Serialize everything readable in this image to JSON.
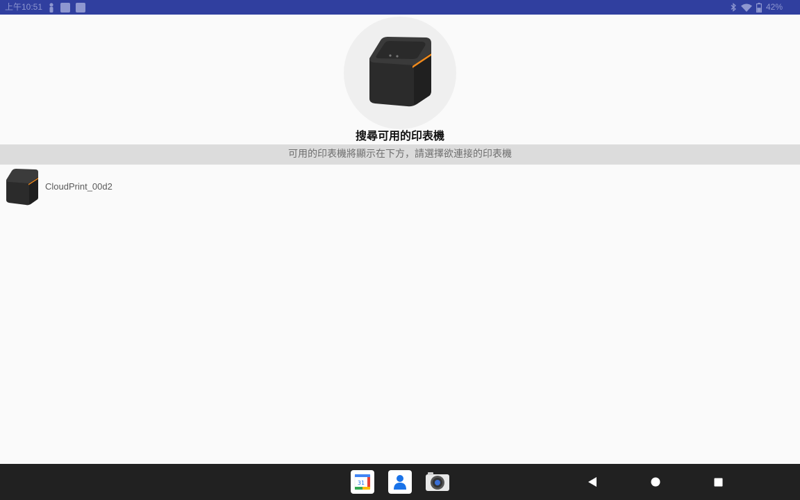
{
  "status_bar": {
    "time": "上午10:51",
    "battery": "42%",
    "icons": [
      "person-icon",
      "notification-square-icon",
      "notification-square-icon",
      "bluetooth-icon",
      "wifi-icon",
      "battery-icon"
    ]
  },
  "header": {
    "title": "搜尋可用的印表機",
    "subtitle": "可用的印表機將顯示在下方，請選擇欲連接的印表機"
  },
  "printers": [
    {
      "name": "CloudPrint_00d2",
      "icon": "printer-icon"
    }
  ],
  "dock": {
    "apps": [
      {
        "name": "calendar",
        "badge": "31"
      },
      {
        "name": "contacts"
      },
      {
        "name": "camera"
      }
    ]
  },
  "nav": {
    "buttons": [
      "back-icon",
      "home-icon",
      "recents-icon"
    ]
  },
  "colors": {
    "status_bar": "#303f9f",
    "banner": "#dcdcdc",
    "nav_bar": "#212121",
    "accent_orange": "#f08a1c"
  }
}
